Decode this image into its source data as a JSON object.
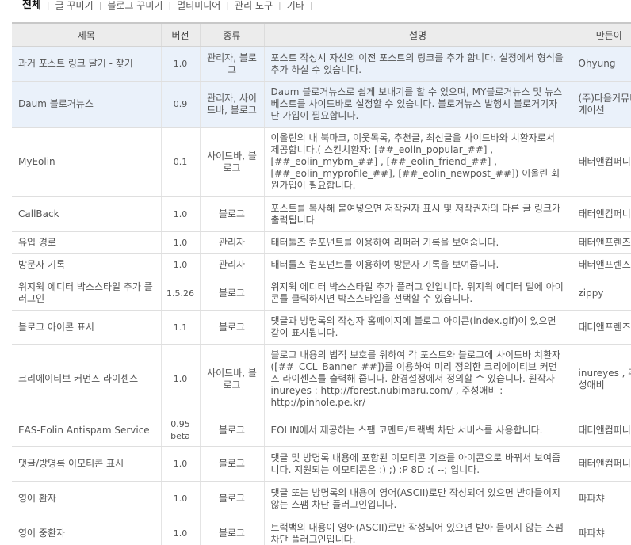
{
  "filters": [
    {
      "label": "전체",
      "active": true
    },
    {
      "label": "글 꾸미기",
      "active": false
    },
    {
      "label": "블로그 꾸미기",
      "active": false
    },
    {
      "label": "멀티미디어",
      "active": false
    },
    {
      "label": "관리 도구",
      "active": false
    },
    {
      "label": "기타",
      "active": false
    }
  ],
  "filter_separator": "|",
  "table": {
    "headers": {
      "title": "제목",
      "version": "버전",
      "scope": "종류",
      "description": "설명",
      "author": "만든이"
    },
    "rows": [
      {
        "title": "과거 포스트 링크 달기 - 찾기",
        "version": "1.0",
        "scope": "관리자, 블로그",
        "description": "포스트 작성시 자신의 이전 포스트의 링크를 추가 합니다. 설정에서 형식을 추가 하실 수 있습니다.",
        "author": "Ohyung"
      },
      {
        "title": "Daum 블로거뉴스",
        "version": "0.9",
        "scope": "관리자, 사이드바, 블로그",
        "description": "Daum 블로거뉴스로 쉽게 보내기를 할 수 있으며, MY블로거뉴스 및 뉴스베스트를 사이드바로 설정할 수 있습니다. 블로거뉴스 발행시 블로거기자단 가입이 필요합니다.",
        "author": "(주)다음커뮤니케이션"
      },
      {
        "title": "MyEolin",
        "version": "0.1",
        "scope": "사이드바, 블로그",
        "description": "이올린의 내 북마크, 이웃목록, 추천글, 최신글을 사이드바와 치환자로서 제공합니다.( 스킨치환자: [##_eolin_popular_##] , [##_eolin_mybm_##] , [##_eolin_friend_##] , [##_eolin_myprofile_##], [##_eolin_newpost_##]) 이올린 회원가입이 필요합니다.",
        "author": "태터앤컴퍼니"
      },
      {
        "title": "CallBack",
        "version": "1.0",
        "scope": "블로그",
        "description": "포스트를 복사해 붙여넣으면 저작권자 표시 및 저작권자의 다른 글 링크가 출력됩니다",
        "author": "태터앤컴퍼니"
      },
      {
        "title": "유입 경로",
        "version": "1.0",
        "scope": "관리자",
        "description": "태터툴즈 컴포넌트를 이용하여 리퍼러 기록을 보여줍니다.",
        "author": "태터앤프렌즈"
      },
      {
        "title": "방문자 기록",
        "version": "1.0",
        "scope": "관리자",
        "description": "태터툴즈 컴포넌트를 이용하여 방문자 기록을 보여줍니다.",
        "author": "태터앤프렌즈"
      },
      {
        "title": "위지윅 에디터 박스스타일 추가 플러그인",
        "version": "1.5.26",
        "scope": "블로그",
        "description": "위지윅 에디터 박스스타일 추가 플러그 인입니다. 위지윅 에디터 밑에 아이콘를 클릭하시면 박스스타일을 선택할 수 있습니다.",
        "author": "zippy"
      },
      {
        "title": "블로그 아이콘 표시",
        "version": "1.1",
        "scope": "블로그",
        "description": "댓글과 방명록의 작성자 홈페이지에 블로그 아이콘(index.gif)이 있으면 같이 표시됩니다.",
        "author": "태터앤프렌즈"
      },
      {
        "title": "크리에이티브 커먼즈 라이센스",
        "version": "1.0",
        "scope": "사이드바, 블로그",
        "description": "블로그 내용의 법적 보호를 위하여 각 포스트와 블로그에 사이드바 치환자([##_CCL_Banner_##])를 이용하여 미리 정의한 크리에이티브 커먼즈 라이센스를 출력해 줍니다. 환경설정에서 정의할 수 있습니다. 원작자 inureyes : http://forest.nubimaru.com/ , 주성애비 : http://pinhole.pe.kr/",
        "author": "inureyes , 주성애비"
      },
      {
        "title": "EAS-Eolin Antispam Service",
        "version": "0.95 beta",
        "scope": "블로그",
        "description": "EOLIN에서 제공하는 스팸 코멘트/트랙백 차단 서비스를 사용합니다.",
        "author": "태터앤컴퍼니"
      },
      {
        "title": "댓글/방명록 이모티콘 표시",
        "version": "1.0",
        "scope": "블로그",
        "description": "댓글 및 방명록 내용에 포함된 이모티콘 기호를 아이콘으로 바꿔서 보여줍니다. 지원되는 이모티콘은 :) ;) :P 8D :( --; 입니다.",
        "author": "태터앤컴퍼니"
      },
      {
        "title": "영어 환자",
        "version": "1.0",
        "scope": "블로그",
        "description": "댓글 또는 방명록의 내용이 영어(ASCII)로만 작성되어 있으면 받아들이지 않는 스팸 차단 플러그인입니다.",
        "author": "파파챠"
      },
      {
        "title": "영어 중환자",
        "version": "1.0",
        "scope": "블로그",
        "description": "트랙백의 내용이 영어(ASCII)로만 작성되어 있으면 받아 들이지 않는 스팸 차단 플러그인입니다.",
        "author": "파파챠"
      }
    ]
  },
  "colors": {
    "row_alt_bg": "#eaf1fa",
    "header_bg": "#ececec",
    "text": "#555555"
  }
}
